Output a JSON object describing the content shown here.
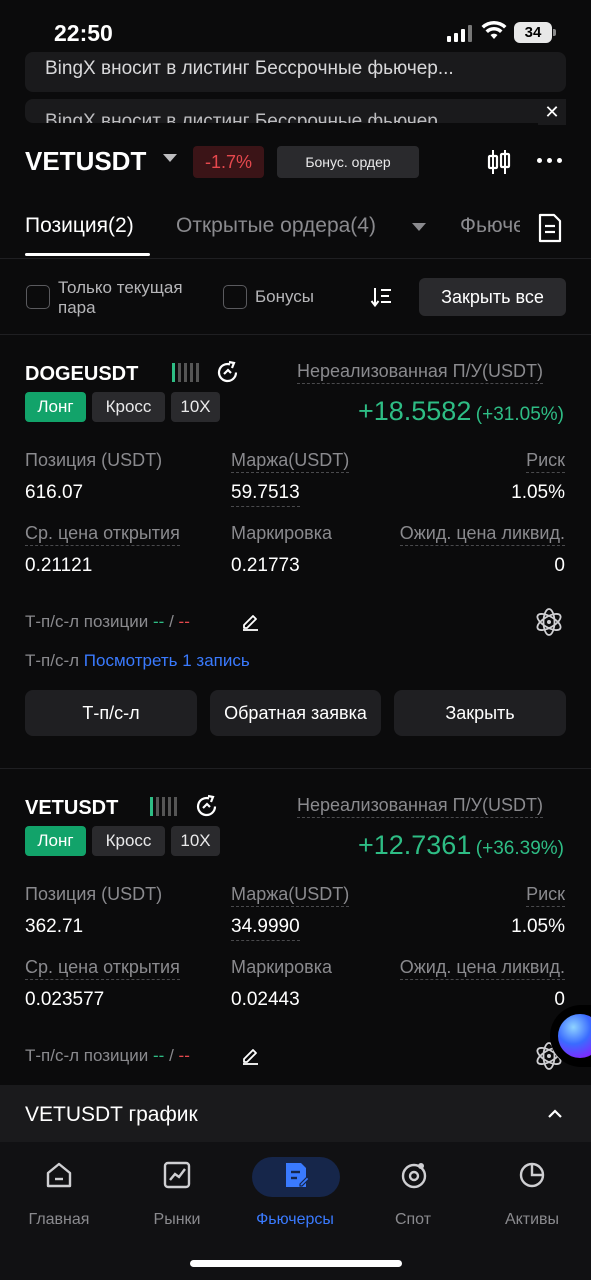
{
  "status_bar": {
    "time": "22:50",
    "battery": "34"
  },
  "announcements": [
    {
      "text": "BingX вносит в листинг Бессрочные фьючер..."
    },
    {
      "text": "BingX вносит в листинг Бессрочные фьючер..."
    }
  ],
  "header": {
    "pair": "VETUSDT",
    "change": "-1.7%",
    "bonus_order": "Бонус. ордер"
  },
  "tabs": [
    {
      "label": "Позиция(2)"
    },
    {
      "label": "Открытые ордера(4)"
    },
    {
      "label": "Фьючерсы"
    }
  ],
  "filters": {
    "current_pair_only": "Только текущая пара",
    "bonuses": "Бонусы",
    "close_all": "Закрыть все"
  },
  "positions": [
    {
      "symbol": "DOGEUSDT",
      "side": "Лонг",
      "margin_mode": "Кросс",
      "leverage": "10X",
      "pnl_label": "Нереализованная П/У(USDT)",
      "pnl": "+18.5582",
      "pnl_pct": "(+31.05%)",
      "size_label": "Позиция (USDT)",
      "size": "616.07",
      "margin_label": "Маржа(USDT)",
      "margin": "59.7513",
      "risk_label": "Риск",
      "risk": "1.05%",
      "entry_label": "Ср. цена открытия",
      "entry": "0.21121",
      "mark_label": "Маркировка",
      "mark": "0.21773",
      "liq_label": "Ожид. цена ликвид.",
      "liq": "0",
      "tpsl_label": "Т-п/с-л позиции",
      "tp": "--",
      "sep": "/",
      "sl": "--",
      "tpsl_records_label": "Т-п/с-л",
      "tpsl_records_link": "Посмотреть 1 запись",
      "btn_tpsl": "Т-п/с-л",
      "btn_reverse": "Обратная заявка",
      "btn_close": "Закрыть"
    },
    {
      "symbol": "VETUSDT",
      "side": "Лонг",
      "margin_mode": "Кросс",
      "leverage": "10X",
      "pnl_label": "Нереализованная П/У(USDT)",
      "pnl": "+12.7361",
      "pnl_pct": "(+36.39%)",
      "size_label": "Позиция (USDT)",
      "size": "362.71",
      "margin_label": "Маржа(USDT)",
      "margin": "34.9990",
      "risk_label": "Риск",
      "risk": "1.05%",
      "entry_label": "Ср. цена открытия",
      "entry": "0.023577",
      "mark_label": "Маркировка",
      "mark": "0.02443",
      "liq_label": "Ожид. цена ликвид.",
      "liq": "0",
      "tpsl_label": "Т-п/с-л позиции",
      "tp": "--",
      "sep": "/",
      "sl": "--"
    }
  ],
  "chart_section": {
    "title": "VETUSDT график"
  },
  "bottom_nav": [
    {
      "label": "Главная",
      "icon": "home-icon"
    },
    {
      "label": "Рынки",
      "icon": "markets-icon"
    },
    {
      "label": "Фьючерсы",
      "icon": "futures-icon",
      "active": true
    },
    {
      "label": "Спот",
      "icon": "spot-icon"
    },
    {
      "label": "Активы",
      "icon": "assets-icon"
    }
  ],
  "colors": {
    "positive": "#2ebd85",
    "negative": "#e5484d",
    "accent": "#3a7afe",
    "long_tag": "#12a36a"
  }
}
